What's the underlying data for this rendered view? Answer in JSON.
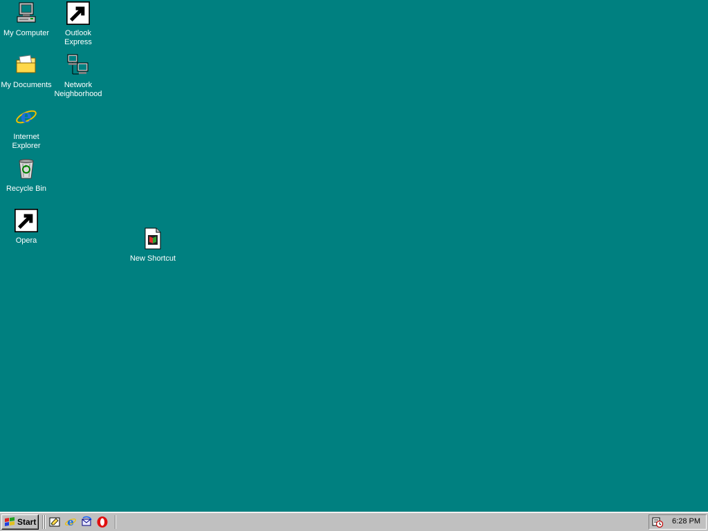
{
  "desktop": {
    "background_color": "#008080",
    "icons": [
      {
        "id": "my-computer",
        "label": "My Computer",
        "icon": "computer-icon"
      },
      {
        "id": "outlook-express",
        "label": "Outlook\nExpress",
        "icon": "outlook-express-icon",
        "shortcut": true
      },
      {
        "id": "my-documents",
        "label": "My Documents",
        "icon": "folder-icon"
      },
      {
        "id": "network-neighborhood",
        "label": "Network\nNeighborhood",
        "icon": "network-icon"
      },
      {
        "id": "internet-explorer",
        "label": "Internet\nExplorer",
        "icon": "internet-explorer-icon"
      },
      {
        "id": "recycle-bin",
        "label": "Recycle Bin",
        "icon": "recycle-bin-icon"
      },
      {
        "id": "opera",
        "label": "Opera",
        "icon": "opera-icon",
        "shortcut": true
      },
      {
        "id": "new-shortcut",
        "label": "New Shortcut",
        "icon": "document-icon"
      }
    ]
  },
  "taskbar": {
    "start_label": "Start",
    "quick_launch": [
      "show-desktop-icon",
      "internet-explorer-icon",
      "outlook-express-icon",
      "opera-icon"
    ],
    "tray": {
      "icon": "scheduler-icon",
      "clock": "6:28 PM"
    }
  }
}
